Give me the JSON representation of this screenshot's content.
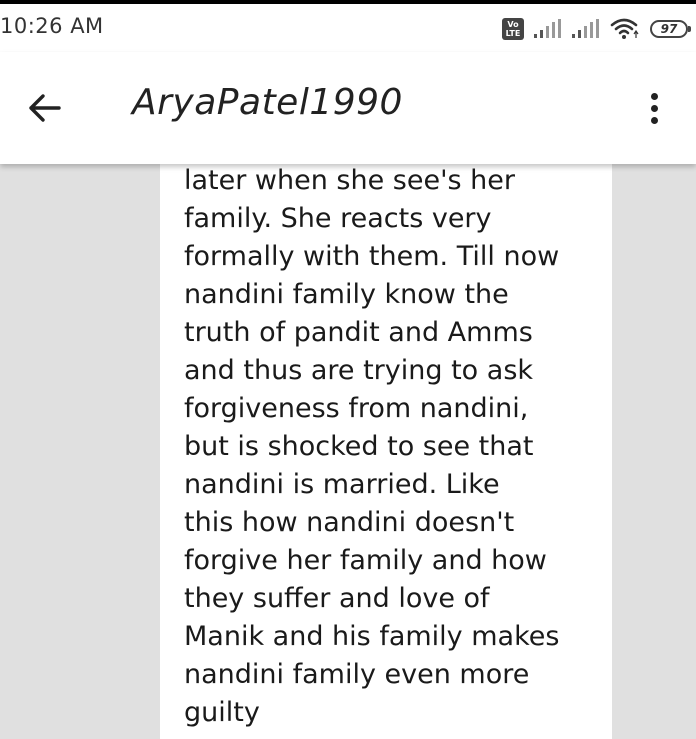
{
  "status_bar": {
    "time": "10:26 AM",
    "volte_top": "Vo",
    "volte_bottom": "LTE",
    "battery": "97"
  },
  "app_bar": {
    "title": "AryaPatel1990"
  },
  "message": {
    "lines": [
      "later when she see's her",
      "family. She reacts very",
      "formally with them. Till now",
      "nandini family know the",
      "truth of pandit and Amms",
      "and thus are trying to ask",
      "forgiveness from nandini,",
      "but is shocked to see that",
      "nandini is married. Like",
      "this how nandini doesn't",
      "forgive her family and how",
      "they suffer and love of",
      "Manik and his family makes",
      "nandini family even more",
      "guilty"
    ]
  },
  "icons": {
    "back": "arrow-left-icon",
    "more": "more-vertical-icon",
    "wifi": "wifi-icon",
    "signal": "signal-icon"
  }
}
